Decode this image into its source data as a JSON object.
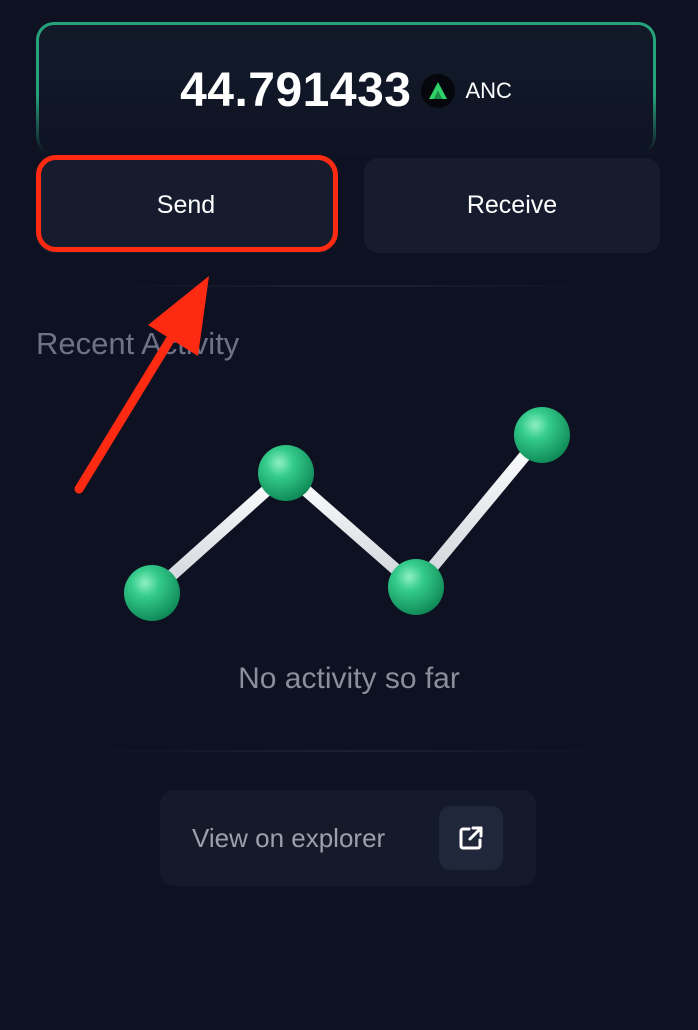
{
  "balance": {
    "amount": "44.791433",
    "token_symbol": "ANC",
    "token_icon": "anchor-token-icon",
    "accent_color": "#27a37b"
  },
  "actions": {
    "send_label": "Send",
    "receive_label": "Receive"
  },
  "activity": {
    "title": "Recent Activity",
    "empty_message": "No activity so far",
    "illustration_icon": "line-chart-illustration-icon"
  },
  "explorer": {
    "label": "View on explorer",
    "icon": "external-link-icon"
  },
  "annotation": {
    "highlight_color": "#ff2a12",
    "target": "Send"
  }
}
